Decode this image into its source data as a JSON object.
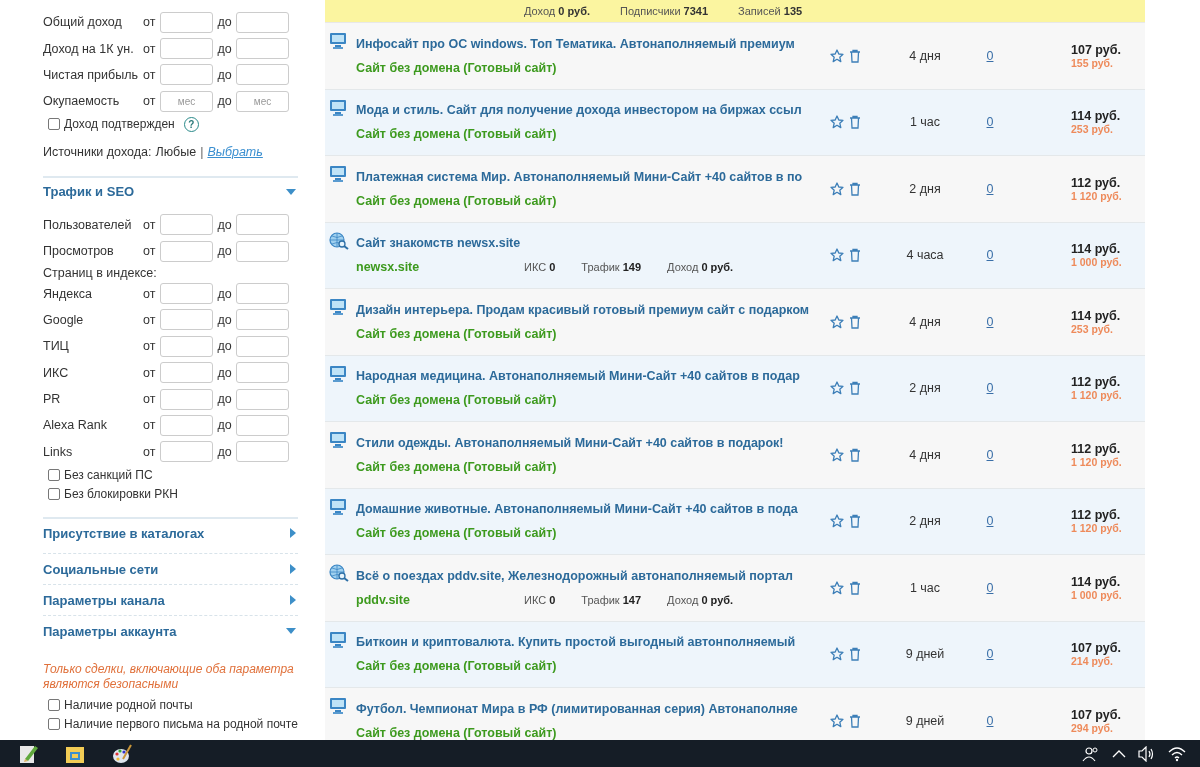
{
  "sidebar": {
    "blocks": [
      {
        "kind": "field",
        "label": "Общий доход",
        "from_label": "от",
        "to_label": "до"
      },
      {
        "kind": "field",
        "label": "Доход на 1К ун.",
        "from_label": "от",
        "to_label": "до"
      },
      {
        "kind": "field",
        "label": "Чистая прибыль",
        "from_label": "от",
        "to_label": "до"
      },
      {
        "kind": "field",
        "label": "Окупаемость",
        "from_label": "от",
        "to_label": "до",
        "from_placeholder": "мес",
        "to_placeholder": "мес"
      },
      {
        "kind": "checkbox",
        "label": "Доход подтвержден",
        "checked": false,
        "help": "?"
      },
      {
        "kind": "sources",
        "label": "Источники дохода:",
        "value": "Любые",
        "separator": "|",
        "link": "Выбрать"
      },
      {
        "kind": "header",
        "title": "Трафик и SEO",
        "expanded": true
      },
      {
        "kind": "field",
        "label": "Пользователей",
        "from_label": "от",
        "to_label": "до"
      },
      {
        "kind": "field",
        "label": "Просмотров",
        "from_label": "от",
        "to_label": "до"
      },
      {
        "kind": "caption",
        "label": "Страниц в индексе:"
      },
      {
        "kind": "field",
        "label": "Яндекса",
        "from_label": "от",
        "to_label": "до"
      },
      {
        "kind": "field",
        "label": "Google",
        "from_label": "от",
        "to_label": "до"
      },
      {
        "kind": "field",
        "label": "ТИЦ",
        "from_label": "от",
        "to_label": "до"
      },
      {
        "kind": "field",
        "label": "ИКС",
        "from_label": "от",
        "to_label": "до"
      },
      {
        "kind": "field",
        "label": "PR",
        "from_label": "от",
        "to_label": "до"
      },
      {
        "kind": "field",
        "label": "Alexa Rank",
        "from_label": "от",
        "to_label": "до"
      },
      {
        "kind": "field",
        "label": "Links",
        "from_label": "от",
        "to_label": "до"
      },
      {
        "kind": "checkbox",
        "label": "Без санкций ПС",
        "checked": false
      },
      {
        "kind": "checkbox",
        "label": "Без блокировки РКН",
        "checked": false
      },
      {
        "kind": "header",
        "title": "Присутствие в каталогах",
        "expanded": false
      },
      {
        "kind": "header",
        "title": "Социальные сети",
        "expanded": false
      },
      {
        "kind": "header",
        "title": "Параметры канала",
        "expanded": false
      },
      {
        "kind": "header",
        "title": "Параметры аккаунта",
        "expanded": true
      },
      {
        "kind": "note",
        "text": "Только сделки, включающие оба параметра являются безопасными"
      },
      {
        "kind": "checkbox",
        "label": "Наличие родной почты",
        "checked": false
      },
      {
        "kind": "checkbox",
        "label": "Наличие первого письма на родной почте",
        "checked": false
      }
    ]
  },
  "featured": {
    "stats": [
      {
        "label": "Доход",
        "value": "0 руб."
      },
      {
        "label": "Подписчики",
        "value": "7341"
      },
      {
        "label": "Записей",
        "value": "135"
      }
    ]
  },
  "listings": [
    {
      "kind": "template",
      "title": "Инфосайт про ОС windows. Топ Тематика. Автонаполняемый премиум",
      "subtitle": "Сайт без домена (Готовый сайт)",
      "age": "4 дня",
      "bids": "0",
      "price": "107 руб.",
      "old_price": "155 руб."
    },
    {
      "kind": "template",
      "title": "Мода и стиль. Сайт для получение дохода инвестором на биржах ссыл",
      "subtitle": "Сайт без домена (Готовый сайт)",
      "age": "1 час",
      "bids": "0",
      "price": "114 руб.",
      "old_price": "253 руб."
    },
    {
      "kind": "template",
      "title": "Платежная система Мир. Автонаполняемый Мини-Сайт +40 сайтов в по",
      "subtitle": "Сайт без домена (Готовый сайт)",
      "age": "2 дня",
      "bids": "0",
      "price": "112 руб.",
      "old_price": "1 120 руб."
    },
    {
      "kind": "domain",
      "title": "Сайт знакомств newsx.site",
      "subtitle": "newsx.site",
      "stats": [
        {
          "label": "ИКС",
          "value": "0"
        },
        {
          "label": "Трафик",
          "value": "149"
        },
        {
          "label": "Доход",
          "value": "0 руб."
        }
      ],
      "age": "4 часа",
      "bids": "0",
      "price": "114 руб.",
      "old_price": "1 000 руб."
    },
    {
      "kind": "template",
      "title": "Дизайн интерьера. Продам красивый готовый премиум сайт с подарком",
      "subtitle": "Сайт без домена (Готовый сайт)",
      "age": "4 дня",
      "bids": "0",
      "price": "114 руб.",
      "old_price": "253 руб."
    },
    {
      "kind": "template",
      "title": "Народная медицина. Автонаполняемый Мини-Сайт +40 сайтов в подар",
      "subtitle": "Сайт без домена (Готовый сайт)",
      "age": "2 дня",
      "bids": "0",
      "price": "112 руб.",
      "old_price": "1 120 руб."
    },
    {
      "kind": "template",
      "title": "Стили одежды. Автонаполняемый Мини-Сайт +40 сайтов в подарок!",
      "subtitle": "Сайт без домена (Готовый сайт)",
      "age": "4 дня",
      "bids": "0",
      "price": "112 руб.",
      "old_price": "1 120 руб."
    },
    {
      "kind": "template",
      "title": "Домашние животные. Автонаполняемый Мини-Сайт +40 сайтов в пода",
      "subtitle": "Сайт без домена (Готовый сайт)",
      "age": "2 дня",
      "bids": "0",
      "price": "112 руб.",
      "old_price": "1 120 руб."
    },
    {
      "kind": "domain",
      "title": "Всё о поездах pddv.site, Железнодорожный автонаполняемый портал",
      "subtitle": "pddv.site",
      "stats": [
        {
          "label": "ИКС",
          "value": "0"
        },
        {
          "label": "Трафик",
          "value": "147"
        },
        {
          "label": "Доход",
          "value": "0 руб."
        }
      ],
      "age": "1 час",
      "bids": "0",
      "price": "114 руб.",
      "old_price": "1 000 руб."
    },
    {
      "kind": "template",
      "title": "Биткоин и криптовалюта. Купить простой выгодный автонполняемый",
      "subtitle": "Сайт без домена (Готовый сайт)",
      "age": "9 дней",
      "bids": "0",
      "price": "107 руб.",
      "old_price": "214 руб."
    },
    {
      "kind": "template",
      "title": "Футбол. Чемпионат Мира в РФ (лимитированная серия) Автонаполняе",
      "subtitle": "Сайт без домена (Готовый сайт)",
      "age": "9 дней",
      "bids": "0",
      "price": "107 руб.",
      "old_price": "294 руб."
    }
  ]
}
